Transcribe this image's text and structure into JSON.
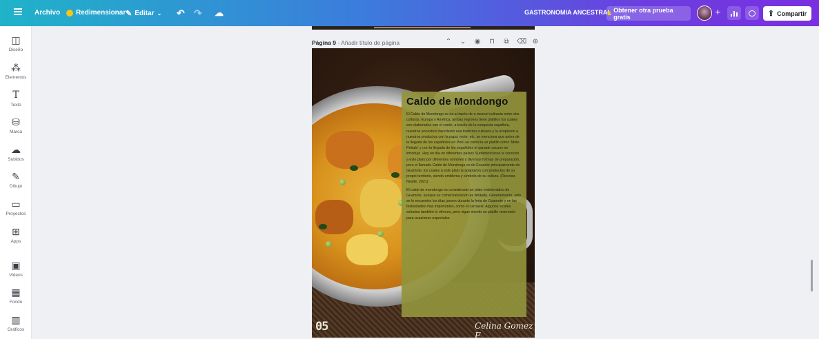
{
  "topbar": {
    "archivo": "Archivo",
    "redimensionar": "Redimensionar",
    "editar": "Editar",
    "document_title": "GASTRONOMIA ANCESTRAL",
    "trial_button": "Obtener otra prueba gratis",
    "share_button": "Compartir"
  },
  "sidebar": {
    "items": [
      {
        "label": "Diseño",
        "icon": "layout-icon"
      },
      {
        "label": "Elementos",
        "icon": "elements-icon"
      },
      {
        "label": "Texto",
        "icon": "text-icon"
      },
      {
        "label": "Marca",
        "icon": "brand-icon"
      },
      {
        "label": "Subidos",
        "icon": "upload-icon"
      },
      {
        "label": "Dibujo",
        "icon": "draw-icon"
      },
      {
        "label": "Proyectos",
        "icon": "folder-icon"
      },
      {
        "label": "Apps",
        "icon": "apps-icon"
      },
      {
        "label": "Videos",
        "icon": "video-icon"
      },
      {
        "label": "Fondo",
        "icon": "background-icon"
      },
      {
        "label": "Gráficos",
        "icon": "charts-icon"
      }
    ]
  },
  "page": {
    "page_label": "Página 9",
    "title_placeholder": "Añadir título de página",
    "page_number": "05",
    "signature": "Celina Gomez F",
    "heading": "Caldo de Mondongo",
    "paragraph_1": "El Caldo de Mondongo se da a través de a mezcal culinaria entre dos culturas. Europa y América, ambas regiones tiene platillos los cuales son elaborados con el cerdo, a través de la conquista española, nuestros ancestros heredaron esa tradicion culinaria y la acoplaron a nuestros productos con la papa, mote, etc. se menciona que antes de la llegada de los españoles en Perú se conocía un platillo como 'Mote Pelado' y con la llegada de los españoles el ganado vacuno se introdujo. Hoy en día en diferentes países Sudamericanos le conocen a este plato por diferentes nombres y diversas formas de preparación, pero el llamado Caldo de Mondongo es de Ecuador principalmente de Guamote, los cuales a este plato la adaptaron con productos de su propio territorio, siendo emblema y símbolo de su cultura. (Recetas Nestlé, 2021)",
    "paragraph_2": "El caldo de mondongo es considerado un plato emblemático de Guamote, aunque su comercialización es limitada. Generalmente, solo se lo encuentra los días jueves durante la feria de Guamote y en las festividades más importantes, como el carnaval. Algunos locales selectos también lo ofrecen, pero sigue siendo un platillo reservado para ocasiones especiales."
  },
  "colors": {
    "panel": "#91943c",
    "topbar_start": "#20b3c9",
    "topbar_end": "#7a2fe0"
  }
}
